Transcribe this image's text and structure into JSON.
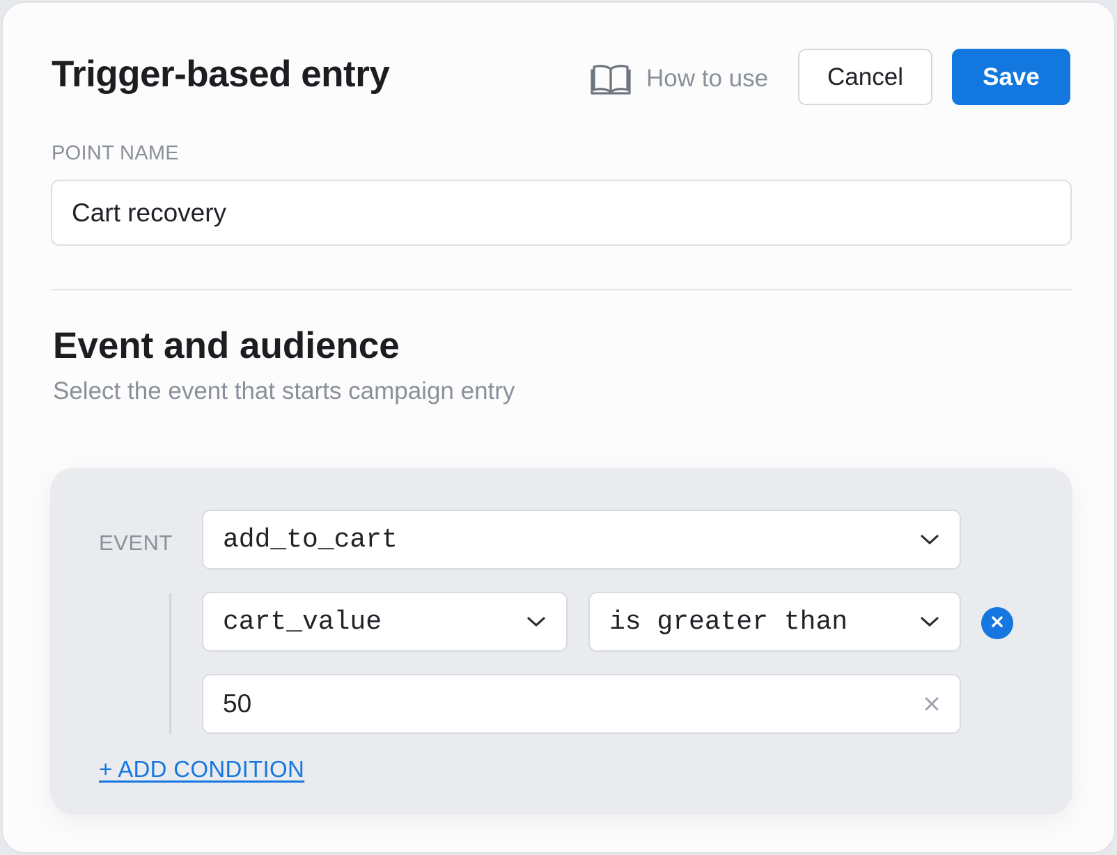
{
  "header": {
    "title": "Trigger-based entry",
    "how_to_use": "How to use",
    "cancel_label": "Cancel",
    "save_label": "Save",
    "book_icon": "book-icon"
  },
  "point_name": {
    "label": "POINT NAME",
    "value": "Cart recovery"
  },
  "section": {
    "title": "Event and audience",
    "subtitle": "Select the event that starts campaign entry"
  },
  "event": {
    "label": "EVENT",
    "selected": "add_to_cart",
    "condition": {
      "property": "cart_value",
      "operator": "is greater than",
      "value": "50"
    },
    "add_condition_label": "+ ADD CONDITION"
  },
  "colors": {
    "accent": "#1278e0",
    "muted_text": "#8a9099",
    "panel_bg": "#e9ebee"
  }
}
